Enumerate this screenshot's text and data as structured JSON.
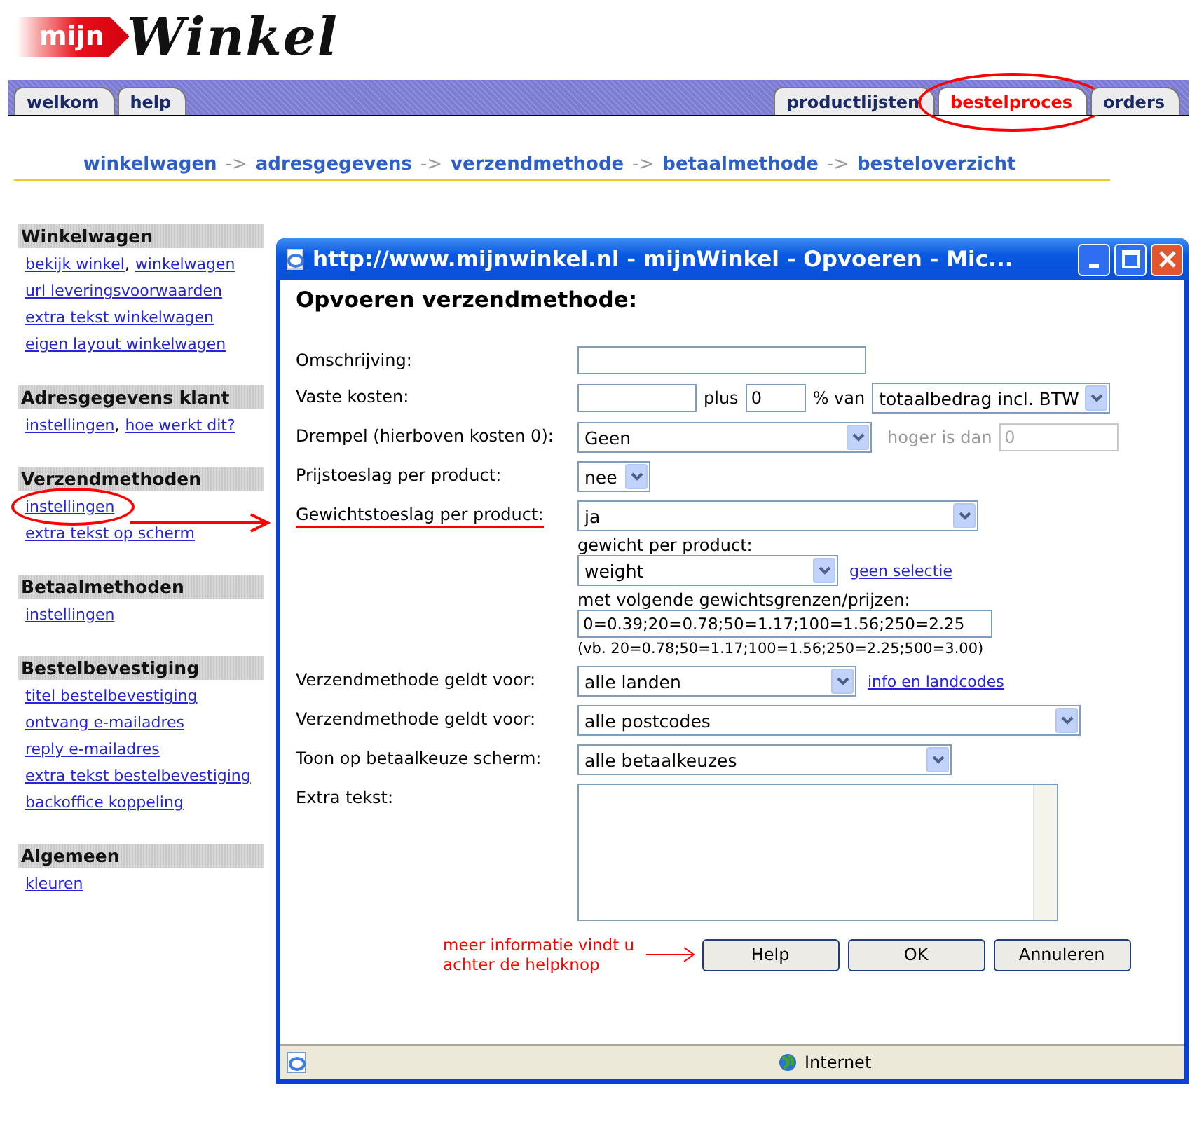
{
  "logo": {
    "badge": "mijn",
    "name": "Winkel"
  },
  "tabs_left": [
    {
      "label": "welkom",
      "selected": false,
      "circled": false
    },
    {
      "label": "help",
      "selected": false,
      "circled": false
    }
  ],
  "tabs_right": [
    {
      "label": "productlijsten",
      "selected": false,
      "circled": false
    },
    {
      "label": "bestelproces",
      "selected": true,
      "circled": true
    },
    {
      "label": "orders",
      "selected": false,
      "circled": false
    }
  ],
  "breadcrumb": [
    {
      "kind": "step",
      "text": "winkelwagen"
    },
    {
      "kind": "arrow",
      "text": "->"
    },
    {
      "kind": "step",
      "text": "adresgegevens"
    },
    {
      "kind": "arrow",
      "text": "->"
    },
    {
      "kind": "step",
      "text": "verzendmethode"
    },
    {
      "kind": "arrow",
      "text": "->"
    },
    {
      "kind": "step",
      "text": "betaalmethode"
    },
    {
      "kind": "arrow",
      "text": "->"
    },
    {
      "kind": "step",
      "text": "besteloverzicht"
    }
  ],
  "sidebar": [
    {
      "title": "Winkelwagen",
      "lines": [
        [
          {
            "kind": "link",
            "text": "bekijk winkel",
            "circled": false
          },
          {
            "kind": "text",
            "text": ","
          },
          {
            "kind": "link",
            "text": "winkelwagen",
            "circled": false
          }
        ],
        [
          {
            "kind": "link",
            "text": "url leveringsvoorwaarden",
            "circled": false
          }
        ],
        [
          {
            "kind": "link",
            "text": "extra tekst winkelwagen",
            "circled": false
          }
        ],
        [
          {
            "kind": "link",
            "text": "eigen layout winkelwagen",
            "circled": false
          }
        ]
      ]
    },
    {
      "title": "Adresgegevens klant",
      "lines": [
        [
          {
            "kind": "link",
            "text": "instellingen",
            "circled": false
          },
          {
            "kind": "text",
            "text": ","
          },
          {
            "kind": "link",
            "text": "hoe werkt dit?",
            "circled": false
          }
        ]
      ]
    },
    {
      "title": "Verzendmethoden",
      "lines": [
        [
          {
            "kind": "link",
            "text": "instellingen",
            "circled": true
          }
        ],
        [
          {
            "kind": "link",
            "text": "extra tekst op scherm",
            "circled": false
          }
        ]
      ]
    },
    {
      "title": "Betaalmethoden",
      "lines": [
        [
          {
            "kind": "link",
            "text": "instellingen",
            "circled": false
          }
        ]
      ]
    },
    {
      "title": "Bestelbevestiging",
      "lines": [
        [
          {
            "kind": "link",
            "text": "titel bestelbevestiging",
            "circled": false
          }
        ],
        [
          {
            "kind": "link",
            "text": "ontvang e-mailadres",
            "circled": false
          }
        ],
        [
          {
            "kind": "link",
            "text": "reply e-mailadres",
            "circled": false
          }
        ],
        [
          {
            "kind": "link",
            "text": "extra tekst bestelbevestiging",
            "circled": false
          }
        ],
        [
          {
            "kind": "link",
            "text": "backoffice koppeling",
            "circled": false
          }
        ]
      ]
    },
    {
      "title": "Algemeen",
      "lines": [
        [
          {
            "kind": "link",
            "text": "kleuren",
            "circled": false
          }
        ]
      ]
    }
  ],
  "popup": {
    "title": "http://www.mijnwinkel.nl - mijnWinkel - Opvoeren - Mic...",
    "heading": "Opvoeren verzendmethode:",
    "rows": [
      {
        "kind": "input",
        "label": "Omschrijving:",
        "underlined": false
      },
      {
        "kind": "costs",
        "label": "Vaste kosten:",
        "underlined": false,
        "plus": "plus",
        "percent": "0",
        "of": "% van",
        "select": "totaalbedrag incl. BTW"
      },
      {
        "kind": "threshold",
        "label": "Drempel (hierboven kosten 0):",
        "underlined": false,
        "select": "Geen",
        "extra_label": "hoger is dan",
        "extra_value": "0",
        "extra_disabled": true
      },
      {
        "kind": "select",
        "label": "Prijstoeslag per product:",
        "underlined": false,
        "select": "nee"
      },
      {
        "kind": "weight",
        "label": "Gewichtstoeslag per product:",
        "underlined": true,
        "select": "ja",
        "sub_label": "gewicht per product:",
        "sub_select": "weight",
        "link": "geen selectie",
        "limits_label": "met volgende gewichtsgrenzen/prijzen:",
        "limits_value": "0=0.39;20=0.78;50=1.17;100=1.56;250=2.25",
        "example": "(vb. 20=0.78;50=1.17;100=1.56;250=2.25;500=3.00)"
      },
      {
        "kind": "select",
        "label": "Verzendmethode geldt voor:",
        "underlined": false,
        "select": "alle landen",
        "link": "info en landcodes"
      },
      {
        "kind": "select",
        "label": "Verzendmethode geldt voor:",
        "underlined": false,
        "select": "alle postcodes"
      },
      {
        "kind": "select",
        "label": "Toon op betaalkeuze scherm:",
        "underlined": false,
        "select": "alle betaalkeuzes"
      },
      {
        "kind": "textarea",
        "label": "Extra tekst:",
        "underlined": false
      }
    ],
    "note": [
      "meer informatie vindt u",
      "achter de helpknop"
    ],
    "buttons": [
      "Help",
      "OK",
      "Annuleren"
    ],
    "status": "Internet"
  }
}
